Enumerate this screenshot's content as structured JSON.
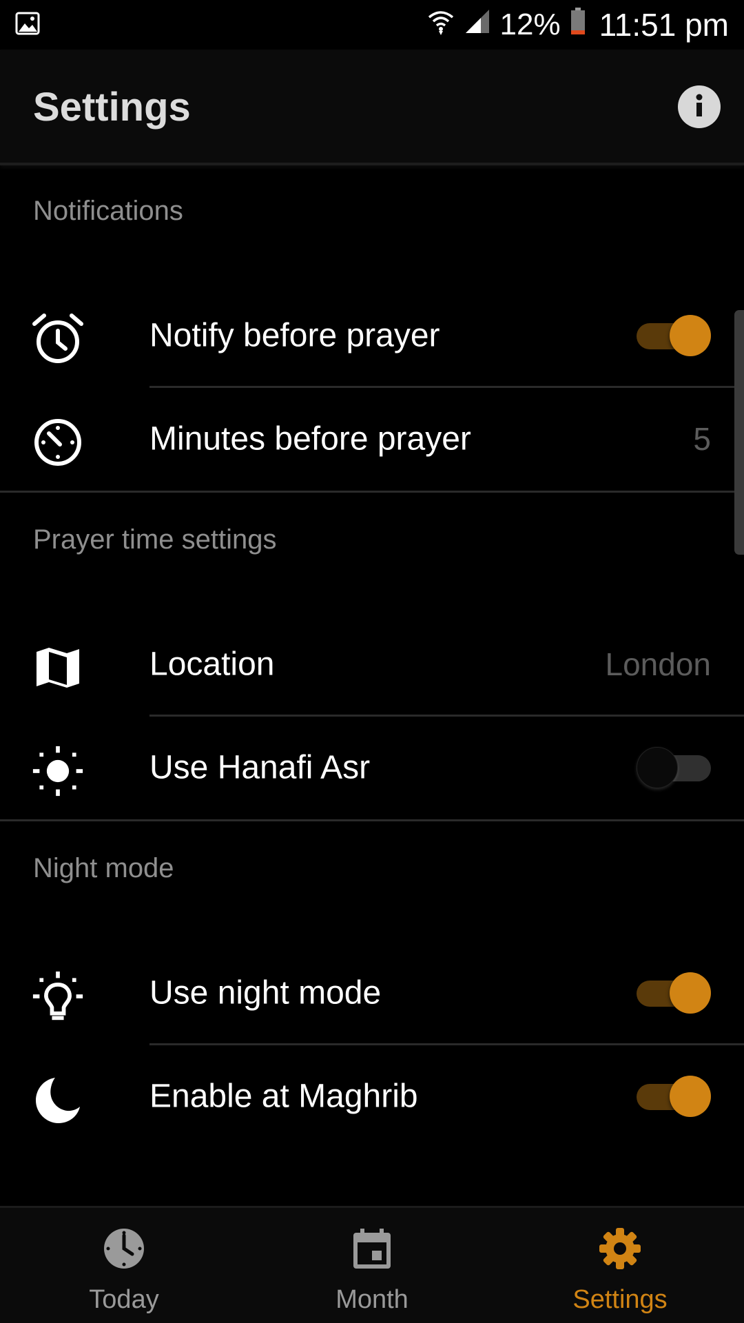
{
  "status_bar": {
    "battery_percent": "12%",
    "time": "11:51 pm",
    "icons": [
      "image-icon",
      "wifi-icon",
      "signal-icon",
      "battery-icon"
    ]
  },
  "app_bar": {
    "title": "Settings",
    "info_icon": "info-icon"
  },
  "sections": {
    "notifications": {
      "header": "Notifications",
      "notify_before_prayer": {
        "label": "Notify before prayer",
        "icon": "alarm-clock-icon",
        "enabled": true
      },
      "minutes_before_prayer": {
        "label": "Minutes before prayer",
        "icon": "timer-icon",
        "value": "5"
      }
    },
    "prayer_time": {
      "header": "Prayer time settings",
      "location": {
        "label": "Location",
        "icon": "map-icon",
        "value": "London"
      },
      "hanafi_asr": {
        "label": "Use Hanafi Asr",
        "icon": "sun-icon",
        "enabled": false
      }
    },
    "night_mode": {
      "header": "Night mode",
      "use_night_mode": {
        "label": "Use night mode",
        "icon": "lightbulb-icon",
        "enabled": true
      },
      "enable_at_maghrib": {
        "label": "Enable at Maghrib",
        "icon": "moon-icon",
        "enabled": true
      }
    }
  },
  "bottom_nav": {
    "items": [
      {
        "label": "Today",
        "icon": "clock-icon",
        "active": false
      },
      {
        "label": "Month",
        "icon": "calendar-icon",
        "active": false
      },
      {
        "label": "Settings",
        "icon": "gear-icon",
        "active": true
      }
    ]
  },
  "colors": {
    "accent": "#d18414",
    "background": "#000000",
    "secondary_text": "#8f8f8f"
  }
}
